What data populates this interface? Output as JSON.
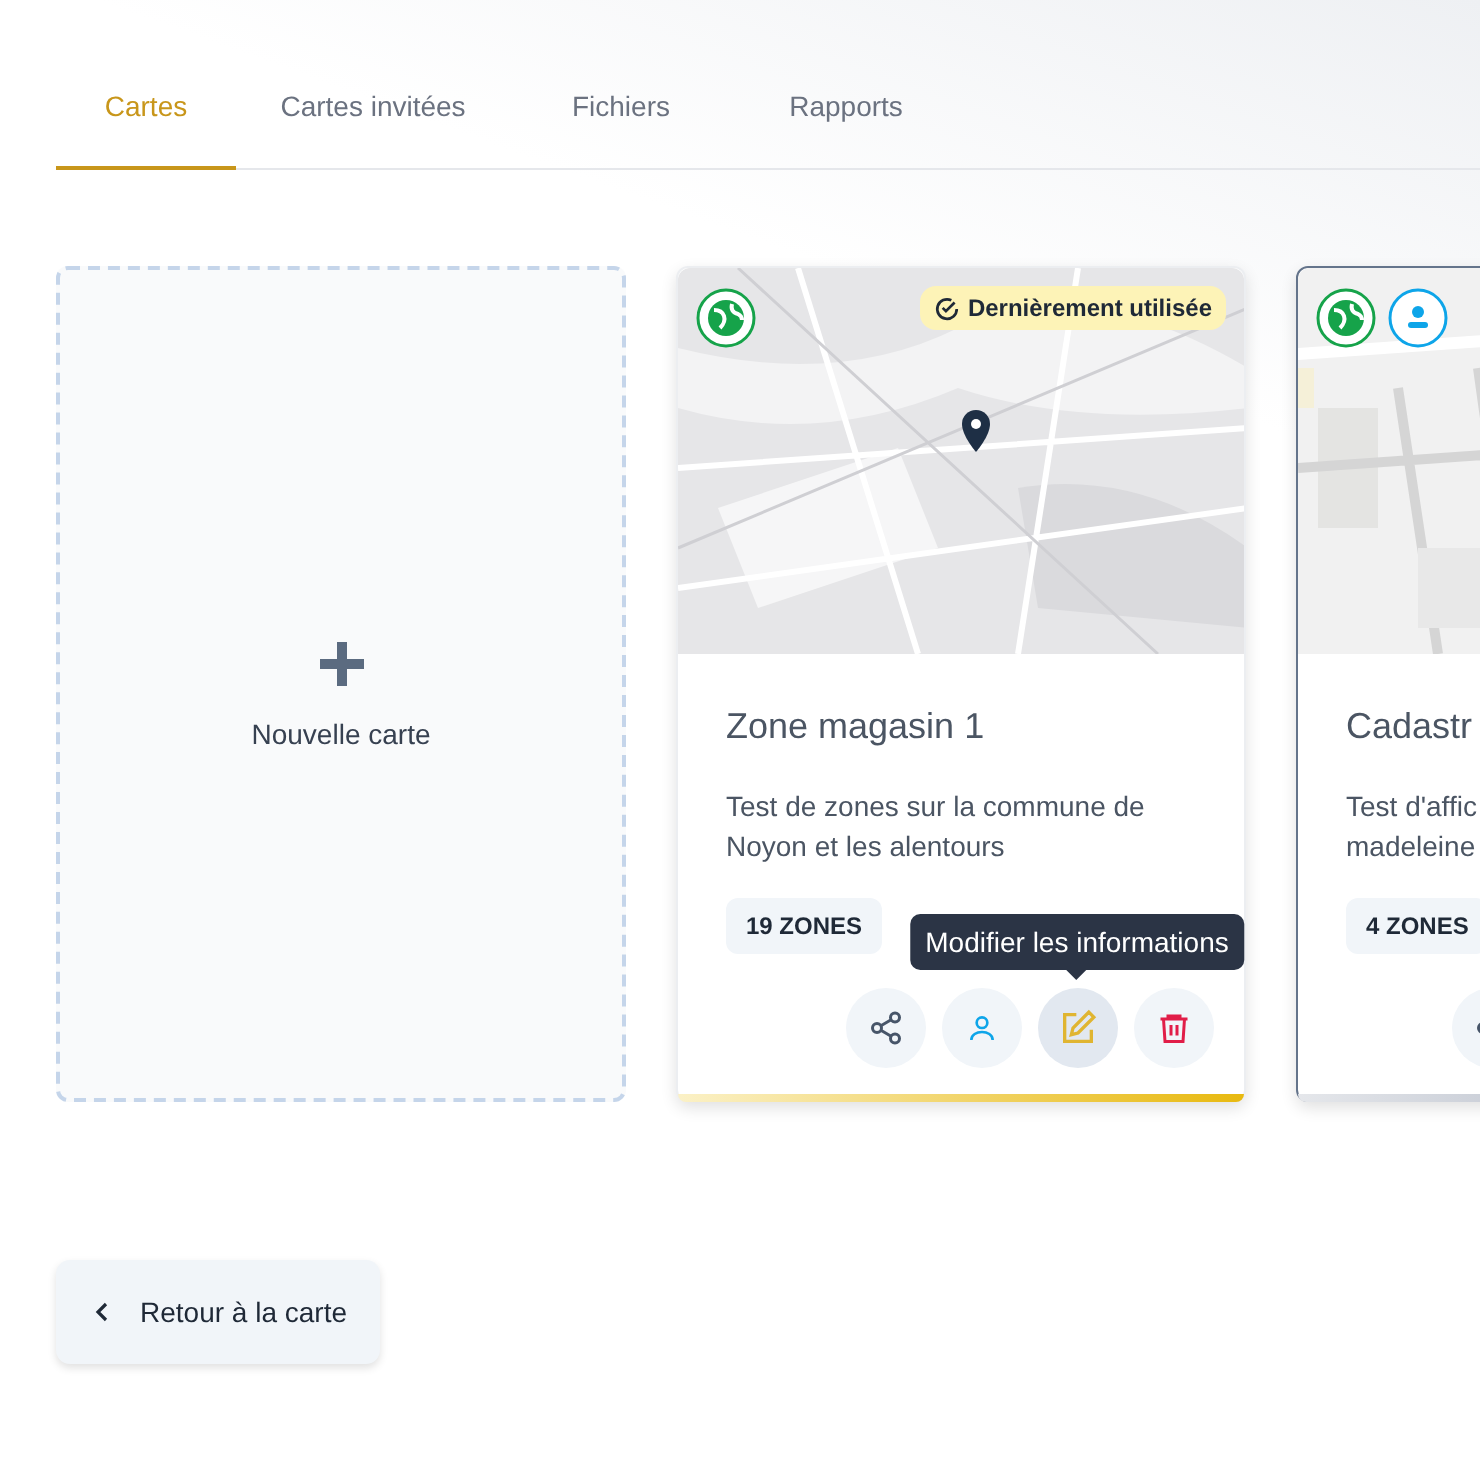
{
  "tabs": [
    {
      "label": "Cartes",
      "selected": true
    },
    {
      "label": "Cartes invitées",
      "selected": false
    },
    {
      "label": "Fichiers",
      "selected": false
    },
    {
      "label": "Rapports",
      "selected": false
    }
  ],
  "new_card": {
    "label": "Nouvelle carte"
  },
  "cards": [
    {
      "title": "Zone magasin 1",
      "lines": [
        "Test de zones sur la commune de",
        "Noyon et les alentours"
      ],
      "zones": "19 ZONES",
      "badge": "Dernièrement utilisée",
      "shared": false,
      "selected": false,
      "last_used": true,
      "actions": [
        {
          "kind": "share"
        },
        {
          "kind": "members"
        },
        {
          "kind": "edit",
          "tooltip": "Modifier les informations"
        },
        {
          "kind": "delete"
        }
      ]
    },
    {
      "title": "Cadastr",
      "lines": [
        "Test d'affic",
        "madeleine"
      ],
      "zones": "4 ZONES",
      "shared": true,
      "selected": true,
      "last_used": false,
      "actions": [
        {
          "kind": "share"
        }
      ]
    }
  ],
  "back_button": {
    "label": "Retour à la carte"
  }
}
